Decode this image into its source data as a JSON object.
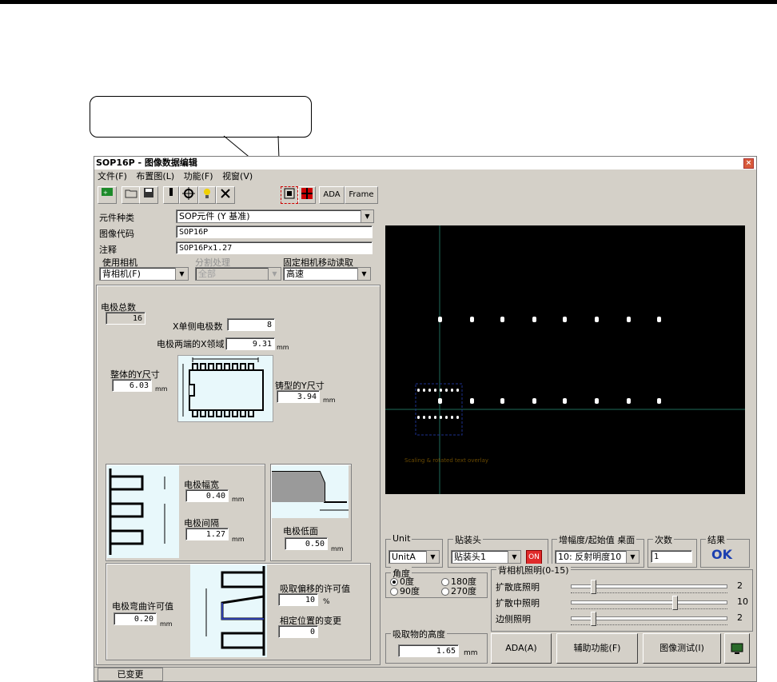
{
  "window": {
    "title": "SOP16P - 图像数据编辑",
    "close": "×"
  },
  "menu": [
    "文件(F)",
    "布置图(L)",
    "功能(F)",
    "视窗(V)"
  ],
  "toolbar": {
    "ada": "ADA",
    "frame": "Frame"
  },
  "form": {
    "part_type_label": "元件种类",
    "part_type_value": "SOP元件 (Y 基准)",
    "image_code_label": "图像代码",
    "image_code_value": "SOP16P",
    "comment_label": "注释",
    "comment_value": "SOP16Px1.27",
    "camera_label": "使用相机",
    "camera_value": "背相机(F)",
    "split_label": "分割处理",
    "split_value": "全部",
    "fixed_cam_label": "固定相机移动读取",
    "fixed_cam_value": "高速"
  },
  "electrodes": {
    "total_label": "电极总数",
    "total_value": "16",
    "x_side_label": "X单侧电极数",
    "x_side_value": "8",
    "x_area_label": "电极两端的X领域",
    "x_area_value": "9.31",
    "overall_y_label": "整体的Y尺寸",
    "overall_y_value": "6.03",
    "mold_y_label": "铸型的Y尺寸",
    "mold_y_value": "3.94",
    "width_label": "电极幅宽",
    "width_value": "0.40",
    "pitch_label": "电极间隔",
    "pitch_value": "1.27",
    "bottom_label": "电极低面",
    "bottom_value": "0.50",
    "bend_label": "电极弯曲许可值",
    "bend_value": "0.20",
    "pick_offset_label": "吸取偏移的许可值",
    "pick_offset_value": "10",
    "pick_offset_unit": "%",
    "relative_pos_label": "相定位置的变更",
    "relative_pos_value": "0",
    "unit_mm": "mm"
  },
  "right": {
    "unit_label": "Unit",
    "unit_value": "UnitA",
    "head_label": "贴装头",
    "head_value": "贴装头1",
    "on_badge": "ON",
    "gain_label": "增幅度/起始值 桌面",
    "gain_value": "10: 反射明度10",
    "count_label": "次数",
    "count_value": "1",
    "result_label": "结果",
    "result_value": "OK",
    "angle_label": "角度",
    "angles": [
      "0度",
      "180度",
      "90度",
      "270度"
    ],
    "light_label": "背相机照明(0-15)",
    "lights": [
      {
        "label": "扩散底照明",
        "value": "2",
        "level": 2
      },
      {
        "label": "扩散中照明",
        "value": "10",
        "level": 10
      },
      {
        "label": "边侧照明",
        "value": "2",
        "level": 2
      }
    ],
    "height_label": "吸取物的高度",
    "height_value": "1.65",
    "height_unit": "mm",
    "btn_ada": "ADA(A)",
    "btn_aux": "辅助功能(F)",
    "btn_test": "图像测试(I)"
  },
  "viewer": {
    "overlay_text": "Scaling & rotated text overlay"
  },
  "status": {
    "text": "已变更"
  }
}
